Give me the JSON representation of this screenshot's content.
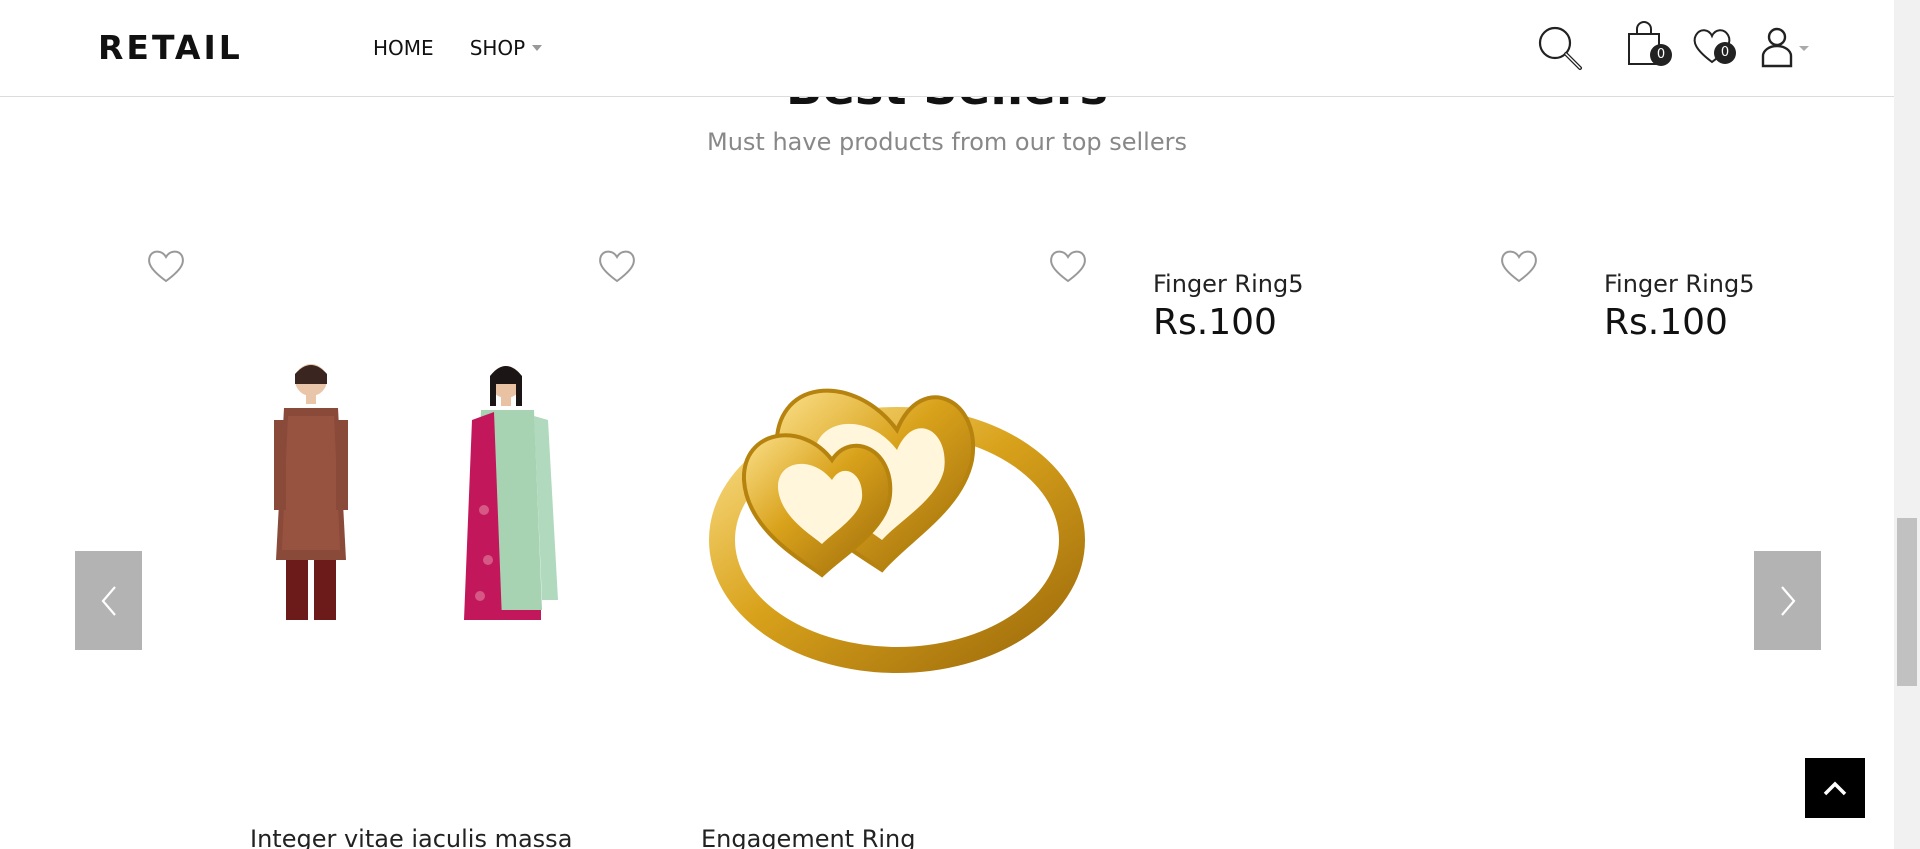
{
  "header": {
    "logo": "RETAIL",
    "nav": [
      {
        "label": "HOME"
      },
      {
        "label": "SHOP"
      }
    ],
    "cart_count": "0",
    "wishlist_count": "0"
  },
  "section": {
    "title": "Best Sellers",
    "subtitle": "Must have products from our top sellers"
  },
  "products": [
    {
      "name": "",
      "price": ""
    },
    {
      "name": "Integer vitae iaculis massa",
      "price": ""
    },
    {
      "name": "Engagement Ring",
      "price": ""
    },
    {
      "name": "Finger Ring5",
      "price": "Rs.100"
    },
    {
      "name": "Finger Ring5",
      "price": "Rs.100"
    }
  ],
  "colors": {
    "arrow_bg": "#b3b3b3",
    "back_to_top_bg": "#000000",
    "badge_bg": "#222222",
    "ring_gold": "#d9a21b"
  }
}
